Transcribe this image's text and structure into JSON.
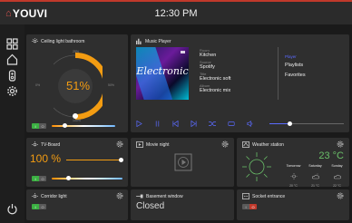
{
  "app": {
    "logo": "YOUVI",
    "time": "12:30 PM"
  },
  "colors": {
    "accent": "#f39c12",
    "brand": "#c0392b",
    "on": "#3cb043",
    "media": "#5b6bff"
  },
  "sidebar": {
    "icons": [
      "grid-icon",
      "home-icon",
      "remote-icon",
      "settings-icon",
      "power-icon"
    ]
  },
  "ceiling": {
    "title": "Ceiling light bathroom",
    "value": "51%",
    "scale": {
      "s0": "0%",
      "s25": "25%",
      "s50": "50%",
      "s75": "75%",
      "s100": "100%"
    },
    "level": 0.51,
    "switch": {
      "on": "I",
      "off": "O"
    }
  },
  "music": {
    "title": "Music Player",
    "cover": "Electronic",
    "fields": [
      {
        "label": "Room",
        "value": "Kitchen"
      },
      {
        "label": "Source",
        "value": "Spotify"
      },
      {
        "label": "Title",
        "value": "Electronic soft"
      },
      {
        "label": "Album",
        "value": "Electronic mix"
      }
    ],
    "menu": {
      "label": "Player",
      "items": [
        "Playlists",
        "Favorites"
      ]
    }
  },
  "tvboard": {
    "title": "TV-Board",
    "value": "100 %",
    "level": 1.0,
    "switch": {
      "on": "I",
      "off": "O"
    }
  },
  "movie": {
    "title": "Movie night"
  },
  "weather": {
    "title": "Weather station",
    "temp": "23 °C",
    "days": [
      {
        "day": "Tomorrow",
        "temp": "20 °C",
        "icon": "sun-icon"
      },
      {
        "day": "Saturday",
        "temp": "21 °C",
        "icon": "cloud-sun-icon"
      },
      {
        "day": "Sunday",
        "temp": "22 °C",
        "icon": "cloud-icon"
      }
    ]
  },
  "corridor": {
    "title": "Corridor light",
    "switch": {
      "on": "I",
      "off": "O"
    }
  },
  "basement": {
    "title": "Basement window",
    "status": "Closed"
  },
  "socket": {
    "title": "Socket entrance",
    "switch": {
      "on": "I",
      "off": "O"
    }
  }
}
